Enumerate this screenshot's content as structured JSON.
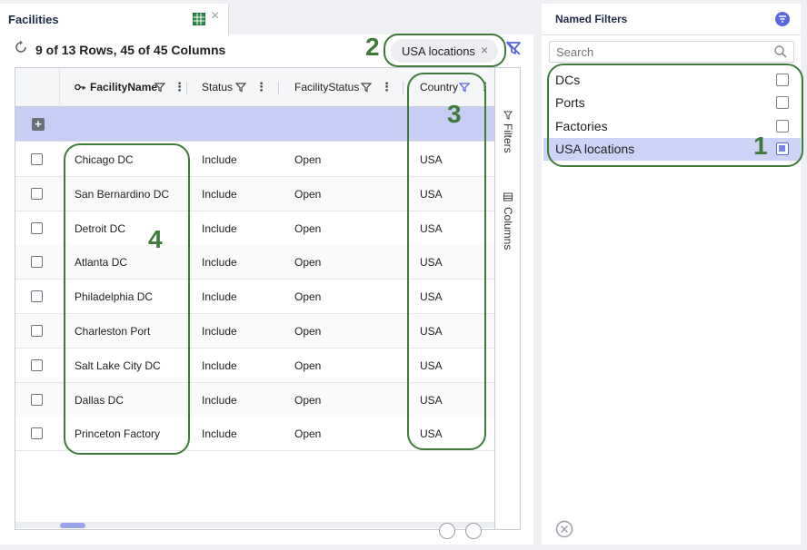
{
  "left_tab": {
    "title": "Facilities",
    "grid_icon": "spreadsheet-icon",
    "close": "×"
  },
  "toolbar": {
    "row_count": "9 of 13 Rows, 45 of 45 Columns"
  },
  "chip": {
    "label": "USA locations",
    "close": "×"
  },
  "columns": [
    {
      "label": "FacilityName",
      "key_icon": "key-icon"
    },
    {
      "label": "Status"
    },
    {
      "label": "FacilityStatus"
    },
    {
      "label": "Country"
    }
  ],
  "rows": [
    {
      "name": "Chicago DC",
      "status": "Include",
      "facility_status": "Open",
      "country": "USA"
    },
    {
      "name": "San Bernardino DC",
      "status": "Include",
      "facility_status": "Open",
      "country": "USA"
    },
    {
      "name": "Detroit DC",
      "status": "Include",
      "facility_status": "Open",
      "country": "USA"
    },
    {
      "name": "Atlanta DC",
      "status": "Include",
      "facility_status": "Open",
      "country": "USA"
    },
    {
      "name": "Philadelphia DC",
      "status": "Include",
      "facility_status": "Open",
      "country": "USA"
    },
    {
      "name": "Charleston Port",
      "status": "Include",
      "facility_status": "Open",
      "country": "USA"
    },
    {
      "name": "Salt Lake City DC",
      "status": "Include",
      "facility_status": "Open",
      "country": "USA"
    },
    {
      "name": "Dallas DC",
      "status": "Include",
      "facility_status": "Open",
      "country": "USA"
    },
    {
      "name": "Princeton Factory",
      "status": "Include",
      "facility_status": "Open",
      "country": "USA"
    }
  ],
  "side_tabs": {
    "filters": "Filters",
    "columns": "Columns"
  },
  "named_filters": {
    "title": "Named Filters",
    "search_placeholder": "Search",
    "items": [
      {
        "label": "DCs",
        "checked": false
      },
      {
        "label": "Ports",
        "checked": false
      },
      {
        "label": "Factories",
        "checked": false
      },
      {
        "label": "USA locations",
        "checked": true
      }
    ]
  },
  "annotations": {
    "a1": "1",
    "a2": "2",
    "a3": "3",
    "a4": "4"
  },
  "colors": {
    "accent": "#5b67e0",
    "annotation": "#3f7a3b",
    "selected_row": "#cdd2f7",
    "add_row": "#c7cdf5"
  }
}
